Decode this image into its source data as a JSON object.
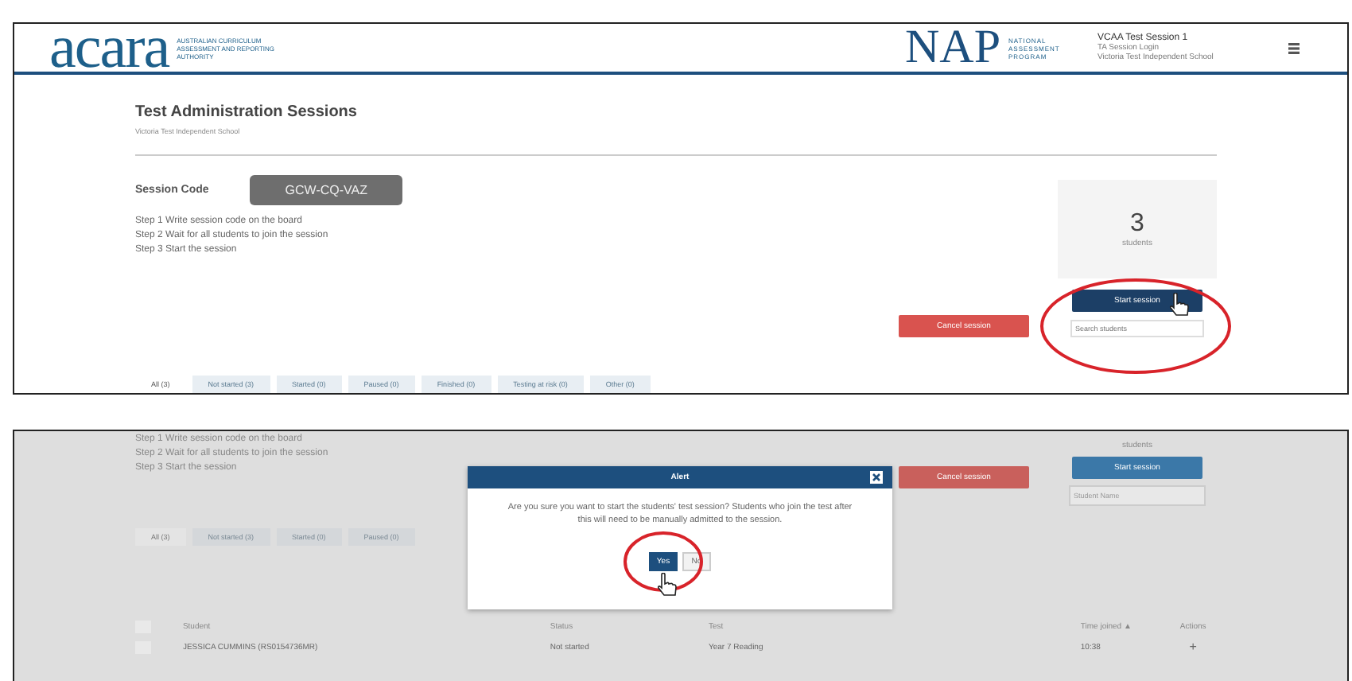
{
  "session_page": {
    "header": {
      "logo": "acara",
      "logo_tagline": "AUSTRALIAN CURRICULUM ASSESSMENT AND REPORTING AUTHORITY",
      "program_logo": "NAP",
      "program_tagline": "NATIONAL ASSESSMENT PROGRAM",
      "user": {
        "session": "VCAA Test Session 1",
        "role": "TA Session Login",
        "school": "Victoria Test Independent School"
      }
    },
    "title": "Test Administration Sessions",
    "subtitle": "Victoria Test Independent School",
    "session_code_label": "Session Code",
    "session_code": "GCW-CQ-VAZ",
    "steps": [
      "Step 1  Write session code on the board",
      "Step 2  Wait for all students to join the session",
      "Step 3  Start the session"
    ],
    "student_count": "3",
    "student_count_label": "students",
    "cancel_button": "Cancel session",
    "start_button": "Start session",
    "search": {
      "placeholder": "Search students"
    },
    "tabs": [
      {
        "label": "All (3)",
        "selected": true
      },
      {
        "label": "Not started (3)",
        "selected": false
      },
      {
        "label": "Started (0)",
        "selected": false
      },
      {
        "label": "Paused (0)",
        "selected": false
      },
      {
        "label": "Finished (0)",
        "selected": false
      },
      {
        "label": "Testing at risk (0)",
        "selected": false
      },
      {
        "label": "Other (0)",
        "selected": false
      }
    ]
  },
  "confirm_page": {
    "steps": [
      "Step 1  Write session code on the board",
      "Step 2  Wait for all students to join the session",
      "Step 3  Start the session"
    ],
    "student_count_label": "students",
    "cancel_button": "Cancel session",
    "start_button": "Start session",
    "sort_select": {
      "value": "Student Name"
    },
    "tabs": [
      {
        "label": "All (3)",
        "selected": true
      },
      {
        "label": "Not started (3)",
        "selected": false
      },
      {
        "label": "Started (0)",
        "selected": false
      },
      {
        "label": "Paused (0)",
        "selected": false
      }
    ],
    "table": {
      "all_checked": false,
      "columns": [
        "Student",
        "Status",
        "Test",
        "Time joined ▲",
        "Actions"
      ],
      "rows": [
        {
          "checked": false,
          "student": "JESSICA CUMMINS (RS0154736MR)",
          "status": "Not started",
          "test": "Year 7 Reading",
          "time": "10:38",
          "action": "+"
        }
      ]
    },
    "dialog": {
      "title": "Alert",
      "message": "Are you sure you want to start the students' test session? Students who join the test after this will need to be manually admitted to the session.",
      "buttons": [
        "Yes",
        "No"
      ]
    }
  }
}
